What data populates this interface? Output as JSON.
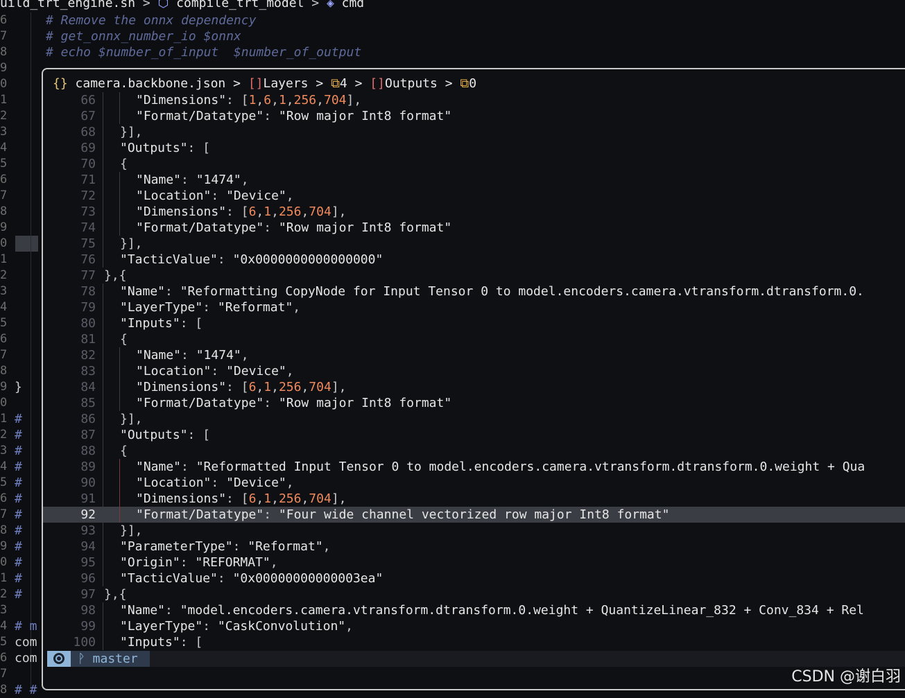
{
  "background": {
    "breadcrumb": [
      "uild_trt_engine.sh",
      ">",
      "compile_trt_model",
      ">",
      "cmd"
    ],
    "gutter": [
      "6",
      "7",
      "8",
      "9",
      "0",
      "1",
      "2",
      "3",
      "4",
      "5",
      "6",
      "7",
      "8",
      "9",
      "0",
      "1",
      "2",
      "3",
      "4",
      "5",
      "6",
      "7",
      "8",
      "9",
      "0",
      "1",
      "2",
      "3",
      "4",
      "5",
      "6",
      "7",
      "8",
      "9",
      "0",
      "1",
      "2",
      "3",
      "4",
      "5",
      "6",
      "7",
      "8"
    ],
    "comments": [
      "# Remove the onnx dependency",
      "# get_onnx_number_io $onnx",
      "# echo $number_of_input  $number_of_output"
    ],
    "left_col": [
      "}",
      "#",
      "#",
      "#",
      "#",
      "#",
      "#",
      "#",
      "#",
      "#",
      "#",
      "#",
      "#",
      "# m",
      "com",
      "com",
      "# #"
    ]
  },
  "float": {
    "breadcrumb": {
      "file": "camera.backbone.json",
      "parts": [
        "Layers",
        "4",
        "Outputs",
        "0"
      ]
    },
    "lines": [
      {
        "n": "66",
        "indent": 2,
        "tokens": [
          [
            "k",
            "\"Dimensions\""
          ],
          [
            "p",
            ": ["
          ],
          [
            "n",
            "1"
          ],
          [
            "p",
            ","
          ],
          [
            "n",
            "6"
          ],
          [
            "p",
            ","
          ],
          [
            "n",
            "1"
          ],
          [
            "p",
            ","
          ],
          [
            "n",
            "256"
          ],
          [
            "p",
            ","
          ],
          [
            "n",
            "704"
          ],
          [
            "p",
            "],"
          ]
        ]
      },
      {
        "n": "67",
        "indent": 2,
        "tokens": [
          [
            "k",
            "\"Format/Datatype\""
          ],
          [
            "p",
            ": "
          ],
          [
            "s",
            "\"Row major Int8 format\""
          ]
        ]
      },
      {
        "n": "68",
        "indent": 1,
        "tokens": [
          [
            "p",
            "}],"
          ]
        ]
      },
      {
        "n": "69",
        "indent": 1,
        "tokens": [
          [
            "k",
            "\"Outputs\""
          ],
          [
            "p",
            ": ["
          ]
        ]
      },
      {
        "n": "70",
        "indent": 1,
        "tokens": [
          [
            "p",
            "{"
          ]
        ]
      },
      {
        "n": "71",
        "indent": 2,
        "tokens": [
          [
            "k",
            "\"Name\""
          ],
          [
            "p",
            ": "
          ],
          [
            "s",
            "\"1474\""
          ],
          [
            "p",
            ","
          ]
        ]
      },
      {
        "n": "72",
        "indent": 2,
        "tokens": [
          [
            "k",
            "\"Location\""
          ],
          [
            "p",
            ": "
          ],
          [
            "s",
            "\"Device\""
          ],
          [
            "p",
            ","
          ]
        ]
      },
      {
        "n": "73",
        "indent": 2,
        "tokens": [
          [
            "k",
            "\"Dimensions\""
          ],
          [
            "p",
            ": ["
          ],
          [
            "n",
            "6"
          ],
          [
            "p",
            ","
          ],
          [
            "n",
            "1"
          ],
          [
            "p",
            ","
          ],
          [
            "n",
            "256"
          ],
          [
            "p",
            ","
          ],
          [
            "n",
            "704"
          ],
          [
            "p",
            "],"
          ]
        ]
      },
      {
        "n": "74",
        "indent": 2,
        "tokens": [
          [
            "k",
            "\"Format/Datatype\""
          ],
          [
            "p",
            ": "
          ],
          [
            "s",
            "\"Row major Int8 format\""
          ]
        ]
      },
      {
        "n": "75",
        "indent": 1,
        "tokens": [
          [
            "p",
            "}],"
          ]
        ]
      },
      {
        "n": "76",
        "indent": 1,
        "tokens": [
          [
            "k",
            "\"TacticValue\""
          ],
          [
            "p",
            ": "
          ],
          [
            "s",
            "\"0x0000000000000000\""
          ]
        ]
      },
      {
        "n": "77",
        "indent": 0,
        "tokens": [
          [
            "p",
            "},{"
          ]
        ]
      },
      {
        "n": "78",
        "indent": 1,
        "tokens": [
          [
            "k",
            "\"Name\""
          ],
          [
            "p",
            ": "
          ],
          [
            "s",
            "\"Reformatting CopyNode for Input Tensor 0 to model.encoders.camera.vtransform.dtransform.0."
          ]
        ]
      },
      {
        "n": "79",
        "indent": 1,
        "tokens": [
          [
            "k",
            "\"LayerType\""
          ],
          [
            "p",
            ": "
          ],
          [
            "s",
            "\"Reformat\""
          ],
          [
            "p",
            ","
          ]
        ]
      },
      {
        "n": "80",
        "indent": 1,
        "tokens": [
          [
            "k",
            "\"Inputs\""
          ],
          [
            "p",
            ": ["
          ]
        ]
      },
      {
        "n": "81",
        "indent": 1,
        "tokens": [
          [
            "p",
            "{"
          ]
        ]
      },
      {
        "n": "82",
        "indent": 2,
        "tokens": [
          [
            "k",
            "\"Name\""
          ],
          [
            "p",
            ": "
          ],
          [
            "s",
            "\"1474\""
          ],
          [
            "p",
            ","
          ]
        ]
      },
      {
        "n": "83",
        "indent": 2,
        "tokens": [
          [
            "k",
            "\"Location\""
          ],
          [
            "p",
            ": "
          ],
          [
            "s",
            "\"Device\""
          ],
          [
            "p",
            ","
          ]
        ]
      },
      {
        "n": "84",
        "indent": 2,
        "tokens": [
          [
            "k",
            "\"Dimensions\""
          ],
          [
            "p",
            ": ["
          ],
          [
            "n",
            "6"
          ],
          [
            "p",
            ","
          ],
          [
            "n",
            "1"
          ],
          [
            "p",
            ","
          ],
          [
            "n",
            "256"
          ],
          [
            "p",
            ","
          ],
          [
            "n",
            "704"
          ],
          [
            "p",
            "],"
          ]
        ]
      },
      {
        "n": "85",
        "indent": 2,
        "tokens": [
          [
            "k",
            "\"Format/Datatype\""
          ],
          [
            "p",
            ": "
          ],
          [
            "s",
            "\"Row major Int8 format\""
          ]
        ]
      },
      {
        "n": "86",
        "indent": 1,
        "tokens": [
          [
            "p",
            "}],"
          ]
        ]
      },
      {
        "n": "87",
        "indent": 1,
        "tokens": [
          [
            "k",
            "\"Outputs\""
          ],
          [
            "p",
            ": ["
          ]
        ]
      },
      {
        "n": "88",
        "indent": 1,
        "tokens": [
          [
            "p",
            "{"
          ]
        ]
      },
      {
        "n": "89",
        "indent": 2,
        "red": true,
        "tokens": [
          [
            "k",
            "\"Name\""
          ],
          [
            "p",
            ": "
          ],
          [
            "s",
            "\"Reformatted Input Tensor 0 to model.encoders.camera.vtransform.dtransform.0.weight + Qua"
          ]
        ]
      },
      {
        "n": "90",
        "indent": 2,
        "red": true,
        "tokens": [
          [
            "k",
            "\"Location\""
          ],
          [
            "p",
            ": "
          ],
          [
            "s",
            "\"Device\""
          ],
          [
            "p",
            ","
          ]
        ]
      },
      {
        "n": "91",
        "indent": 2,
        "red": true,
        "tokens": [
          [
            "k",
            "\"Dimensions\""
          ],
          [
            "p",
            ": ["
          ],
          [
            "n",
            "6"
          ],
          [
            "p",
            ","
          ],
          [
            "n",
            "1"
          ],
          [
            "p",
            ","
          ],
          [
            "n",
            "256"
          ],
          [
            "p",
            ","
          ],
          [
            "n",
            "704"
          ],
          [
            "p",
            "],"
          ]
        ]
      },
      {
        "n": "92",
        "indent": 2,
        "red": true,
        "cur": true,
        "tokens": [
          [
            "k",
            "\"Format/Datatype\""
          ],
          [
            "p",
            ": "
          ],
          [
            "s",
            "\"Four wide channel vectorized row major Int8 format\""
          ]
        ]
      },
      {
        "n": "93",
        "indent": 1,
        "tokens": [
          [
            "p",
            "}],"
          ]
        ]
      },
      {
        "n": "94",
        "indent": 1,
        "tokens": [
          [
            "k",
            "\"ParameterType\""
          ],
          [
            "p",
            ": "
          ],
          [
            "s",
            "\"Reformat\""
          ],
          [
            "p",
            ","
          ]
        ]
      },
      {
        "n": "95",
        "indent": 1,
        "tokens": [
          [
            "k",
            "\"Origin\""
          ],
          [
            "p",
            ": "
          ],
          [
            "s",
            "\"REFORMAT\""
          ],
          [
            "p",
            ","
          ]
        ]
      },
      {
        "n": "96",
        "indent": 1,
        "tokens": [
          [
            "k",
            "\"TacticValue\""
          ],
          [
            "p",
            ": "
          ],
          [
            "s",
            "\"0x00000000000003ea\""
          ]
        ]
      },
      {
        "n": "97",
        "indent": 0,
        "tokens": [
          [
            "p",
            "},{"
          ]
        ]
      },
      {
        "n": "98",
        "indent": 1,
        "tokens": [
          [
            "k",
            "\"Name\""
          ],
          [
            "p",
            ": "
          ],
          [
            "s",
            "\"model.encoders.camera.vtransform.dtransform.0.weight + QuantizeLinear_832 + Conv_834 + Rel"
          ]
        ]
      },
      {
        "n": "99",
        "indent": 1,
        "tokens": [
          [
            "k",
            "\"LayerType\""
          ],
          [
            "p",
            ": "
          ],
          [
            "s",
            "\"CaskConvolution\""
          ],
          [
            "p",
            ","
          ]
        ]
      },
      {
        "n": "100",
        "indent": 1,
        "tokens": [
          [
            "k",
            "\"Inputs\""
          ],
          [
            "p",
            ": ["
          ]
        ]
      }
    ]
  },
  "status": {
    "branch": "master",
    "branch_icon": "git-branch-icon",
    "mode_icon": "circle-icon"
  },
  "watermark": "CSDN @谢白羽",
  "colors": {
    "number": "#f08a5d",
    "comment": "#5f6a9a",
    "status_accent": "#8fb6d8"
  }
}
